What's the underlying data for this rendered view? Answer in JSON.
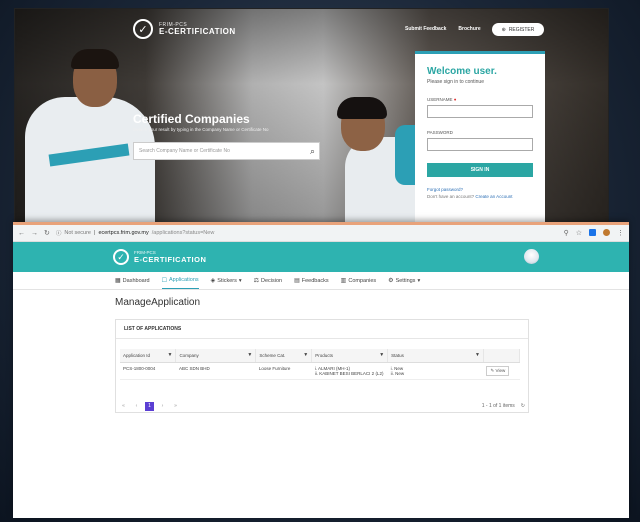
{
  "landing": {
    "logo_small": "FRIM-PCS",
    "logo_big": "E-CERTIFICATION",
    "nav": [
      "Submit Feedback",
      "Brochure"
    ],
    "register_label": "REGISTER",
    "hero_title": "Certified Companies",
    "hero_sub": "Search your result by typing in the Company Name or Certificate No",
    "search_placeholder": "Search Company Name or Certificate No",
    "login": {
      "welcome": "Welcome user.",
      "please": "Please sign in to continue",
      "username_label": "USERNAME",
      "password_label": "PASSWORD",
      "signin_label": "SIGN IN",
      "forgot": "Forgot password?",
      "no_account": "Don't have an account?",
      "create_account": "Create an Account"
    }
  },
  "browser": {
    "not_secure": "Not secure",
    "address": "ecertpcs.frim.gov.my",
    "path": "/applications?status=New"
  },
  "app": {
    "logo_small": "FRIM-PCS",
    "logo_big": "E-CERTIFICATION",
    "menu": [
      {
        "label": "Dashboard",
        "icon": "▦"
      },
      {
        "label": "Applications",
        "icon": "☐"
      },
      {
        "label": "Stickers",
        "icon": "◈"
      },
      {
        "label": "Decision",
        "icon": "⚖"
      },
      {
        "label": "Feedbacks",
        "icon": "▤"
      },
      {
        "label": "Companies",
        "icon": "▥"
      },
      {
        "label": "Settings",
        "icon": "⚙"
      }
    ],
    "page_title": "ManageApplication",
    "panel_title": "LIST OF APPLICATIONS",
    "columns": [
      "Application Id",
      "Company",
      "Scheme Cat.",
      "Products",
      "Status",
      ""
    ],
    "rows": [
      {
        "id": "PCS-1800-0004",
        "company": "ABC SDN BHD",
        "scheme": "Loose Furniture",
        "products_1": "i. ALMARI (MH-1)",
        "products_2": "ii. KABINET BESI BERLACI 2 (L2)",
        "status_1": "i. New",
        "status_2": "ii. New",
        "action": "View"
      }
    ],
    "pager": [
      "«",
      "‹",
      "1",
      "›",
      "»"
    ],
    "pager_info": "1 - 1 of 1 items"
  }
}
